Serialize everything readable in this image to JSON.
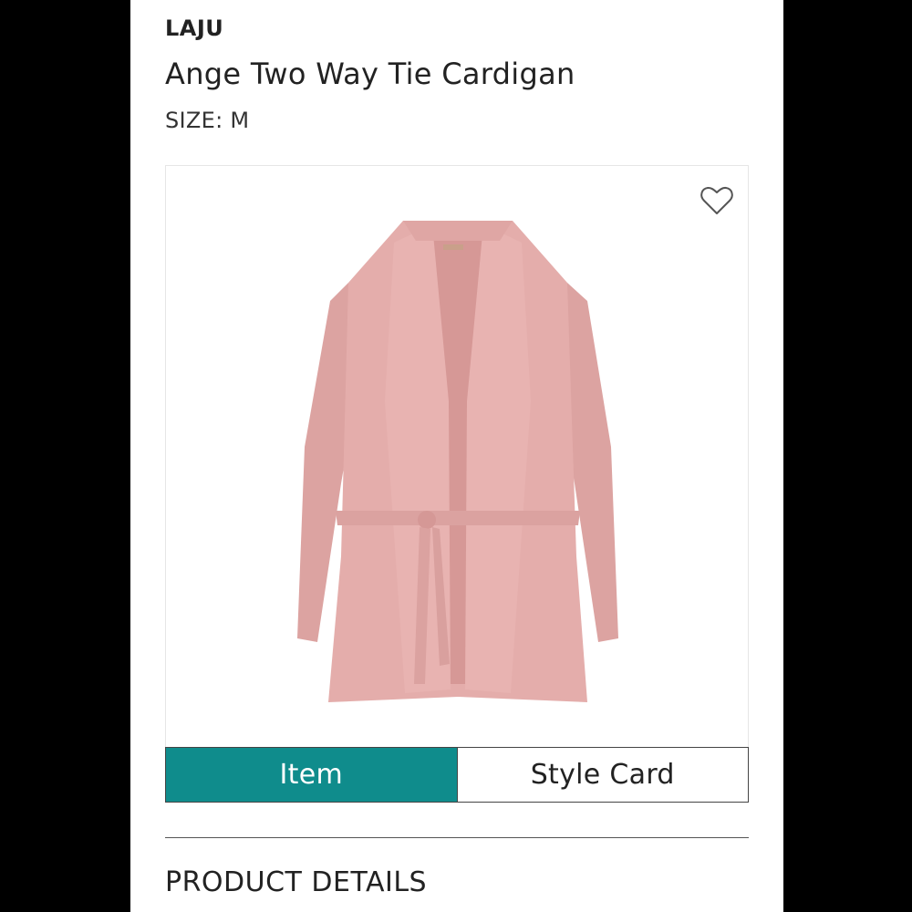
{
  "product": {
    "brand": "LAJU",
    "name": "Ange Two Way Tie Cardigan",
    "size": "SIZE: M",
    "image_subject": "pink-tie-cardigan"
  },
  "icons": {
    "favorite": "heart-outline-icon"
  },
  "tabs": [
    {
      "label": "Item",
      "active": true
    },
    {
      "label": "Style Card",
      "active": false
    }
  ],
  "sections": {
    "product_details_title": "PRODUCT DETAILS"
  },
  "colors": {
    "accent": "#0f8c8c",
    "garment": "#e2aaa8"
  }
}
